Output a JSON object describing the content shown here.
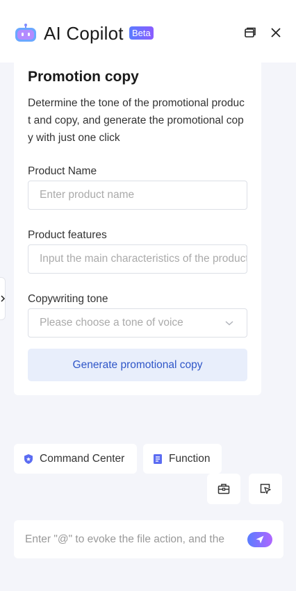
{
  "header": {
    "title": "AI Copilot",
    "badge": "Beta",
    "logo_icon": "robot-icon",
    "split_icon": "window-split-icon",
    "close_icon": "close-icon"
  },
  "card": {
    "title": "Promotion copy",
    "description": "Determine the tone of the promotional product and copy, and generate the promotional copy with just one click",
    "fields": [
      {
        "label": "Product Name",
        "placeholder": "Enter product name"
      },
      {
        "label": "Product features",
        "placeholder": "Input the main characteristics of the product"
      },
      {
        "label": "Copywriting tone",
        "placeholder": "Please choose a tone of voice"
      }
    ],
    "generate_label": "Generate promotional copy"
  },
  "chips": [
    {
      "label": "Command Center",
      "icon": "shield-icon"
    },
    {
      "label": "Function",
      "icon": "document-icon"
    }
  ],
  "toolbar": {
    "briefcase_icon": "toolbox-icon",
    "select_icon": "select-cursor-icon"
  },
  "prompt": {
    "placeholder": "Enter \"@\" to evoke the file action, and the",
    "send_icon": "send-icon"
  },
  "colors": {
    "accent": "#2f56c8",
    "button_bg": "#e8eefb",
    "page_bg": "#f4f5fa"
  }
}
